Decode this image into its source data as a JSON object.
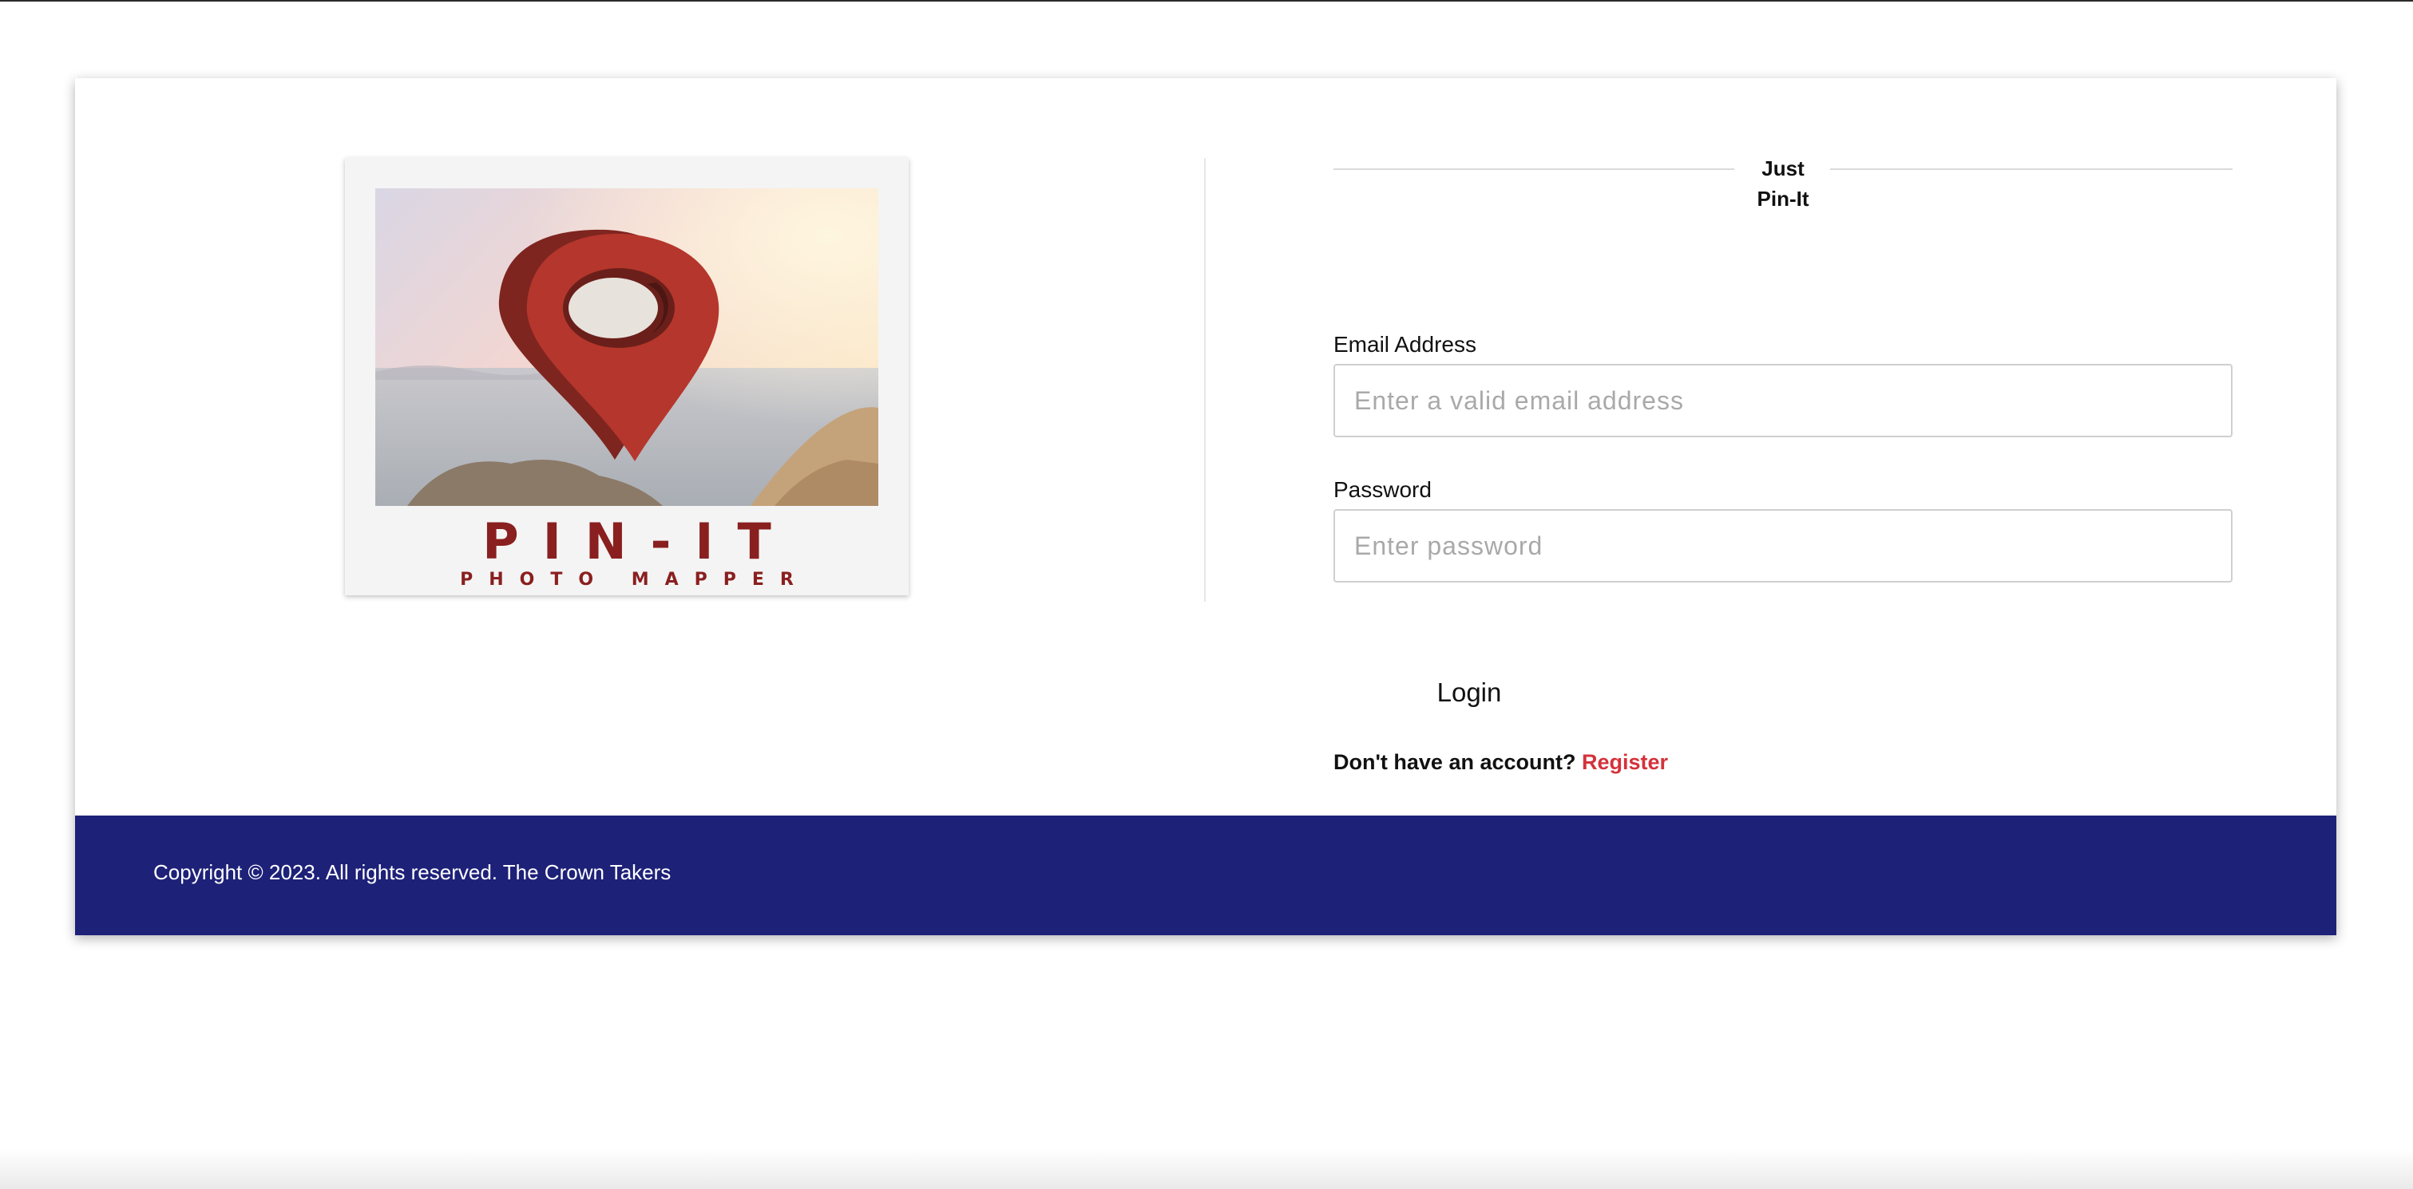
{
  "logo": {
    "title": "PIN-IT",
    "subtitle": "PHOTO MAPPER",
    "accent_color": "#8a1f1f",
    "pin_color": "#b5362c",
    "icon": "map-pin-icon"
  },
  "brand": {
    "line1": "Just",
    "line2": "Pin-It"
  },
  "form": {
    "email_label": "Email Address",
    "email_placeholder": "Enter a valid email address",
    "email_value": "",
    "password_label": "Password",
    "password_placeholder": "Enter password",
    "password_value": "",
    "login_label": "Login",
    "register_prompt": "Don't have an account?",
    "register_link": "Register",
    "link_color": "#d4323b"
  },
  "footer": {
    "copyright": "Copyright © 2023. All rights reserved. The Crown Takers",
    "background_color": "#1e2178"
  }
}
